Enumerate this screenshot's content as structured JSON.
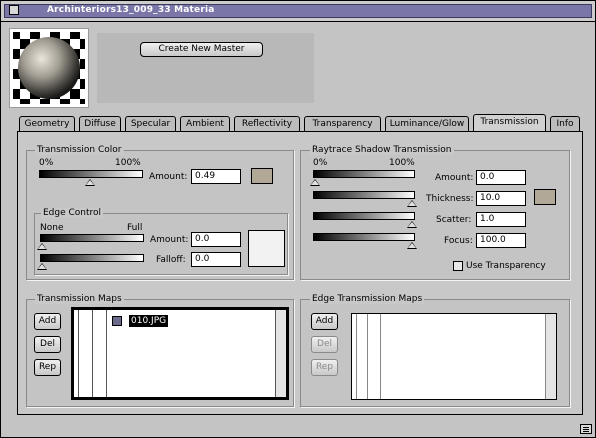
{
  "window": {
    "title": "Archinteriors13_009_33 Materia"
  },
  "master": {
    "create_button": "Create New Master"
  },
  "tabs": [
    {
      "label": "Geometry"
    },
    {
      "label": "Diffuse"
    },
    {
      "label": "Specular"
    },
    {
      "label": "Ambient"
    },
    {
      "label": "Reflectivity"
    },
    {
      "label": "Transparency"
    },
    {
      "label": "Luminance/Glow"
    },
    {
      "label": "Transmission",
      "active": true
    },
    {
      "label": "Info"
    }
  ],
  "transmission_color": {
    "title": "Transmission Color",
    "min_label": "0%",
    "max_label": "100%",
    "amount_label": "Amount:",
    "amount_value": "0.49",
    "slider_level": 0.49,
    "swatch_color": "#b2a898"
  },
  "edge_control": {
    "title": "Edge Control",
    "min_label": "None",
    "max_label": "Full",
    "amount_label": "Amount:",
    "amount_value": "0.0",
    "falloff_label": "Falloff:",
    "falloff_value": "0.0",
    "swatch_color": "#f2f2f2"
  },
  "raytrace": {
    "title": "Raytrace Shadow Transmission",
    "min_label": "0%",
    "max_label": "100%",
    "amount_label": "Amount:",
    "amount_value": "0.0",
    "thickness_label": "Thickness:",
    "thickness_value": "10.0",
    "scatter_label": "Scatter:",
    "scatter_value": "1.0",
    "focus_label": "Focus:",
    "focus_value": "100.0",
    "swatch_color": "#b2a898",
    "use_transparency_label": "Use Transparency"
  },
  "transmission_maps": {
    "title": "Transmission Maps",
    "add": "Add",
    "del": "Del",
    "rep": "Rep",
    "items": [
      {
        "name": "010.JPG"
      }
    ]
  },
  "edge_transmission_maps": {
    "title": "Edge Transmission Maps",
    "add": "Add",
    "del": "Del",
    "rep": "Rep"
  }
}
